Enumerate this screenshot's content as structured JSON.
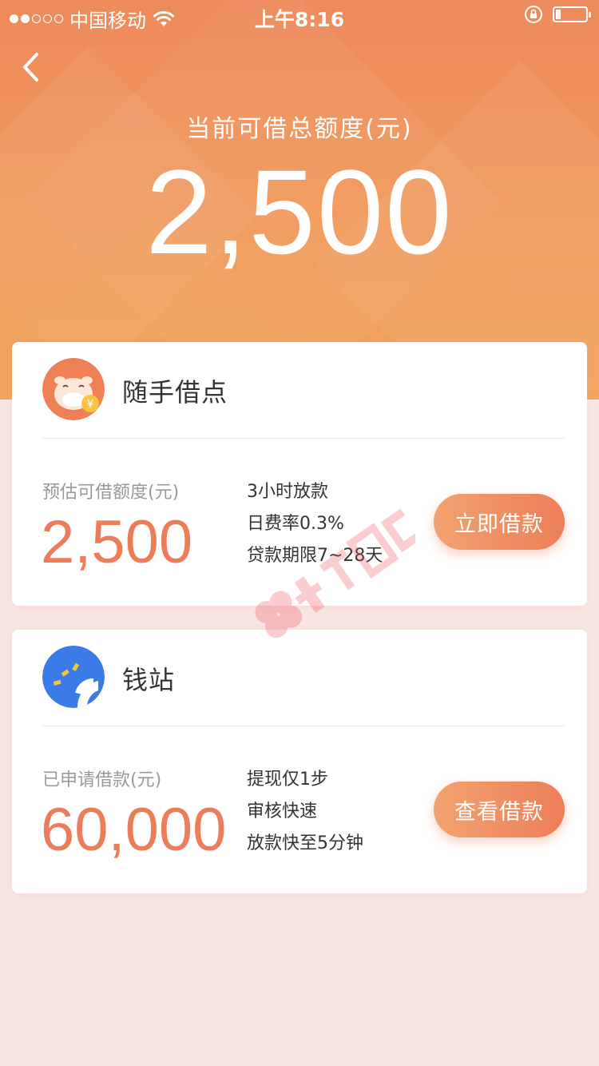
{
  "status_bar": {
    "carrier": "中国移动",
    "time": "上午8:16"
  },
  "header": {
    "title": "当前可借总额度(元)",
    "amount": "2,500"
  },
  "cards": [
    {
      "name": "随手借点",
      "amount_label": "预估可借额度(元)",
      "amount": "2,500",
      "features": [
        "3小时放款",
        "日费率0.3%",
        "贷款期限7~28天"
      ],
      "button_label": "立即借款"
    },
    {
      "name": "钱站",
      "amount_label": "已申请借款(元)",
      "amount": "60,000",
      "features": [
        "提现仅1步",
        "审核快速",
        "放款快至5分钟"
      ],
      "button_label": "查看借款"
    }
  ],
  "colors": {
    "accent": "#ec7d58",
    "header_top": "#ee8a5c",
    "background": "#f9e6e2"
  },
  "icons": [
    "back-icon",
    "wifi-icon",
    "rotation-lock-icon",
    "battery-icon"
  ]
}
